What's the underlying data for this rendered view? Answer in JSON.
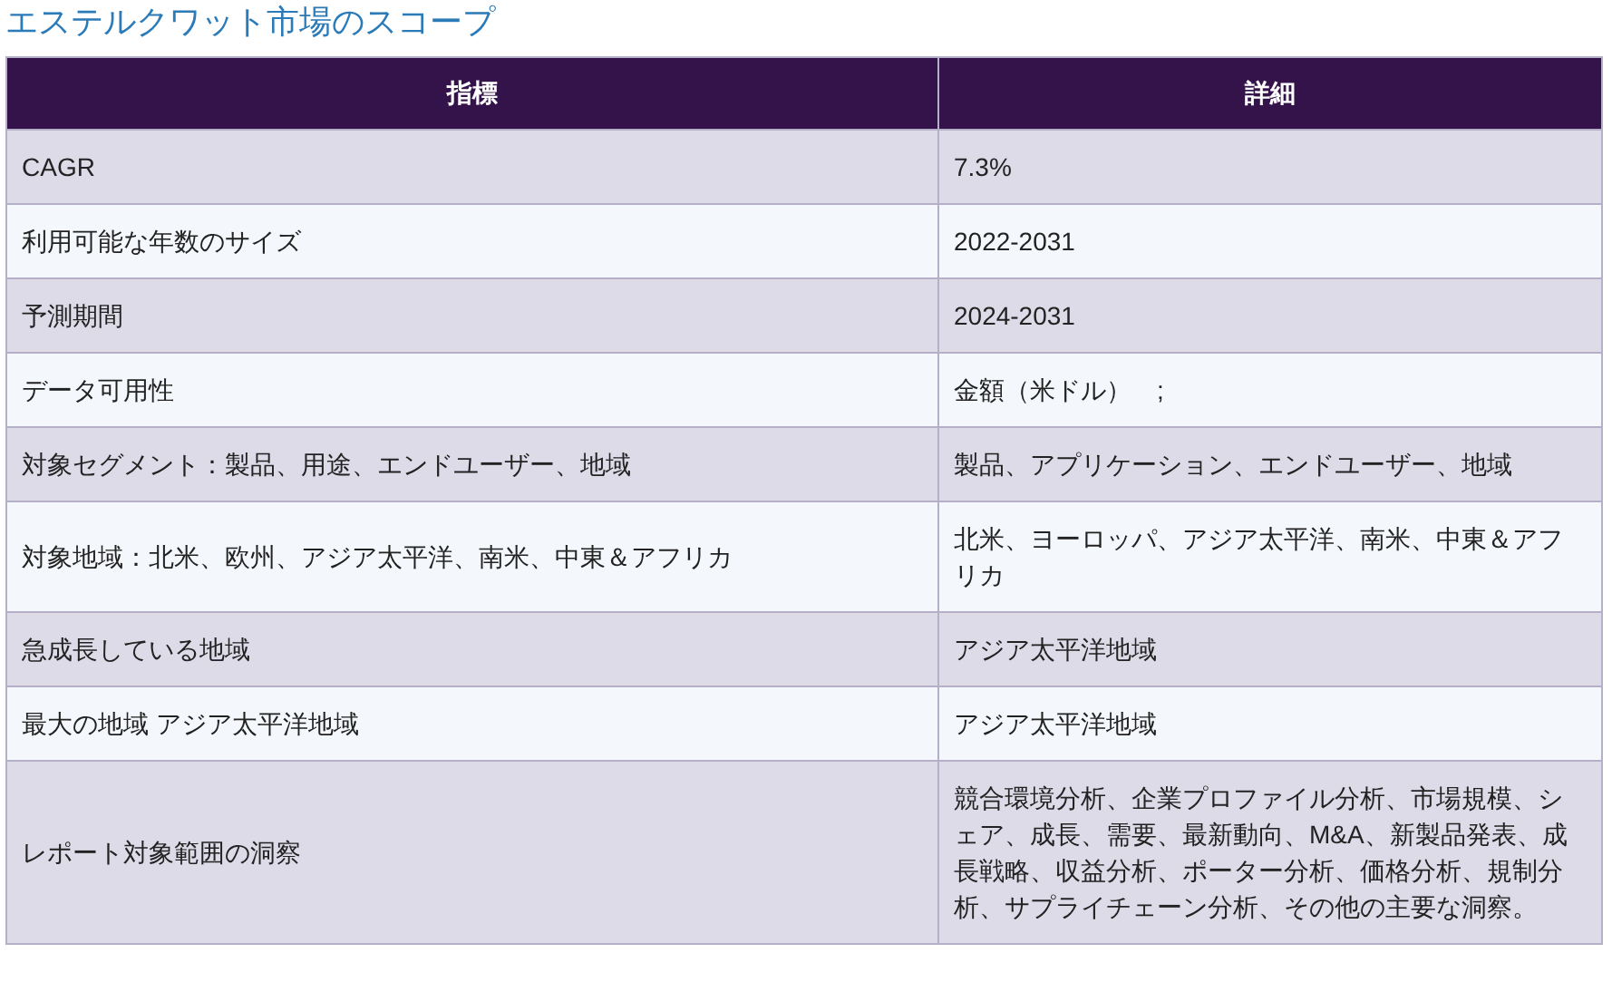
{
  "title": "エステルクワット市場のスコープ",
  "table": {
    "columns": [
      "指標",
      "詳細"
    ],
    "rows": [
      [
        "CAGR",
        "7.3%"
      ],
      [
        "利用可能な年数のサイズ",
        "2022-2031"
      ],
      [
        "予測期間",
        "2024-2031"
      ],
      [
        "データ可用性",
        "金額（米ドル）　;"
      ],
      [
        "対象セグメント：製品、用途、エンドユーザー、地域",
        "製品、アプリケーション、エンドユーザー、地域"
      ],
      [
        "対象地域：北米、欧州、アジア太平洋、南米、中東＆アフリカ",
        "北米、ヨーロッパ、アジア太平洋、南米、中東＆アフリカ"
      ],
      [
        "急成長している地域",
        "アジア太平洋地域"
      ],
      [
        "最大の地域 アジア太平洋地域",
        "アジア太平洋地域"
      ],
      [
        "レポート対象範囲の洞察",
        "競合環境分析、企業プロファイル分析、市場規模、シェア、成長、需要、最新動向、M&A、新製品発表、成長戦略、収益分析、ポーター分析、価格分析、規制分析、サプライチェーン分析、その他の主要な洞察。"
      ]
    ]
  }
}
